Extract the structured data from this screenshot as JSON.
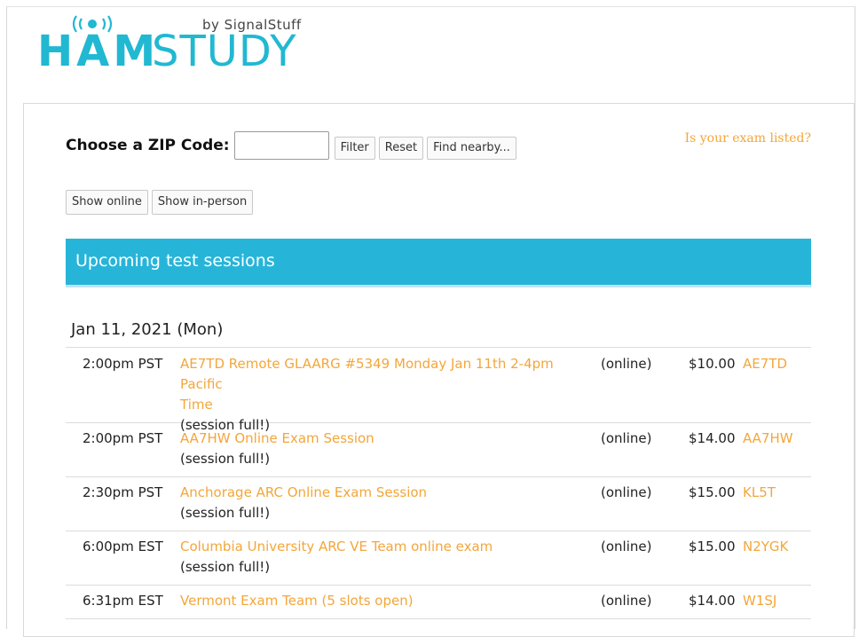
{
  "logo": {
    "ham_text": "HAM",
    "study_text": "STUDY",
    "by_text": "by SignalStuff"
  },
  "filter": {
    "zip_label": "Choose a ZIP Code:",
    "zip_value": "",
    "zip_placeholder": "",
    "filter_label": "Filter",
    "reset_label": "Reset",
    "nearby_label": "Find nearby..."
  },
  "listed_link": "Is your exam listed?",
  "toggles": {
    "online_label": "Show online",
    "inperson_label": "Show in-person"
  },
  "banner_title": "Upcoming test sessions",
  "date_heading": "Jan 11, 2021 (Mon)",
  "sessions": [
    {
      "time": "2:00pm PST",
      "title_line1": "AE7TD Remote GLAARG #5349 Monday Jan 11th 2-4pm Pacific",
      "title_line2": "Time",
      "note": "(session full!)",
      "location": "(online)",
      "fee": "$10.00",
      "callsign": "AE7TD"
    },
    {
      "time": "2:00pm PST",
      "title_line1": "AA7HW Online Exam Session",
      "note": "(session full!)",
      "location": "(online)",
      "fee": "$14.00",
      "callsign": "AA7HW"
    },
    {
      "time": "2:30pm PST",
      "title_line1": "Anchorage ARC Online Exam Session",
      "note": "(session full!)",
      "location": "(online)",
      "fee": "$15.00",
      "callsign": "KL5T"
    },
    {
      "time": "6:00pm EST",
      "title_line1": "Columbia University ARC VE Team online exam",
      "note": "(session full!)",
      "location": "(online)",
      "fee": "$15.00",
      "callsign": "N2YGK"
    },
    {
      "time": "6:31pm EST",
      "title_line1": "Vermont Exam Team (5 slots open)",
      "location": "(online)",
      "fee": "$14.00",
      "callsign": "W1SJ"
    }
  ],
  "colors": {
    "brand": "#21b8d2",
    "banner": "#26b5d9",
    "link": "#f3a63a"
  }
}
